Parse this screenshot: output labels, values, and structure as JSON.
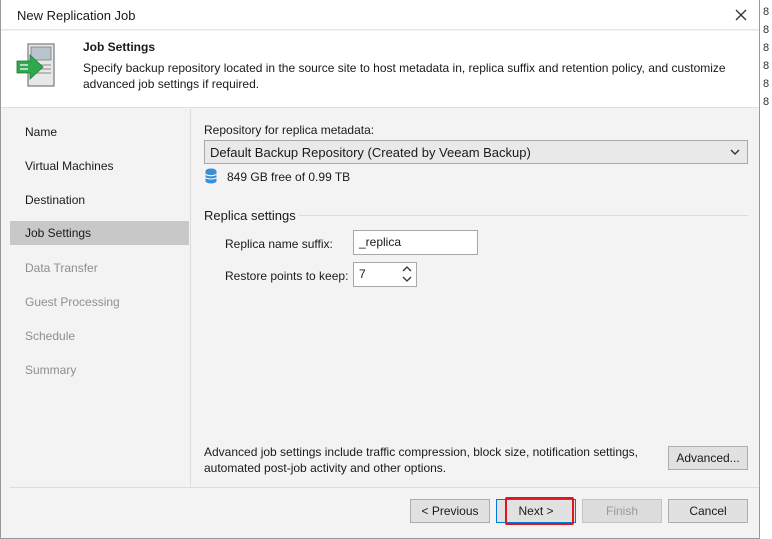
{
  "window": {
    "title": "New Replication Job"
  },
  "header": {
    "title": "Job Settings",
    "description": "Specify backup repository located in the source site to host metadata in, replica suffix and retention policy, and customize advanced job settings if required."
  },
  "sidebar": {
    "items": [
      {
        "label": "Name",
        "state": "normal"
      },
      {
        "label": "Virtual Machines",
        "state": "normal"
      },
      {
        "label": "Destination",
        "state": "normal"
      },
      {
        "label": "Job Settings",
        "state": "active"
      },
      {
        "label": "Data Transfer",
        "state": "disabled"
      },
      {
        "label": "Guest Processing",
        "state": "disabled"
      },
      {
        "label": "Schedule",
        "state": "disabled"
      },
      {
        "label": "Summary",
        "state": "disabled"
      }
    ]
  },
  "main": {
    "repository_label": "Repository for replica metadata:",
    "repository_value": "Default Backup Repository (Created by Veeam Backup)",
    "free_space": "849 GB free of 0.99 TB",
    "replica_section": "Replica settings",
    "suffix_label": "Replica name suffix:",
    "suffix_value": "_replica",
    "restore_label": "Restore points to keep:",
    "restore_value": "7",
    "advanced_text": "Advanced job settings include traffic compression, block size, notification settings, automated post-job activity and other options.",
    "advanced_button": "Advanced..."
  },
  "footer": {
    "previous": "< Previous",
    "next": "Next >",
    "finish": "Finish",
    "cancel": "Cancel"
  },
  "background_strip": [
    "8",
    "8",
    "8",
    "8",
    "8",
    "8"
  ],
  "colors": {
    "highlight": "#e0161e",
    "accent_green": "#2fa84f",
    "active_item": "#c8c8c8"
  }
}
